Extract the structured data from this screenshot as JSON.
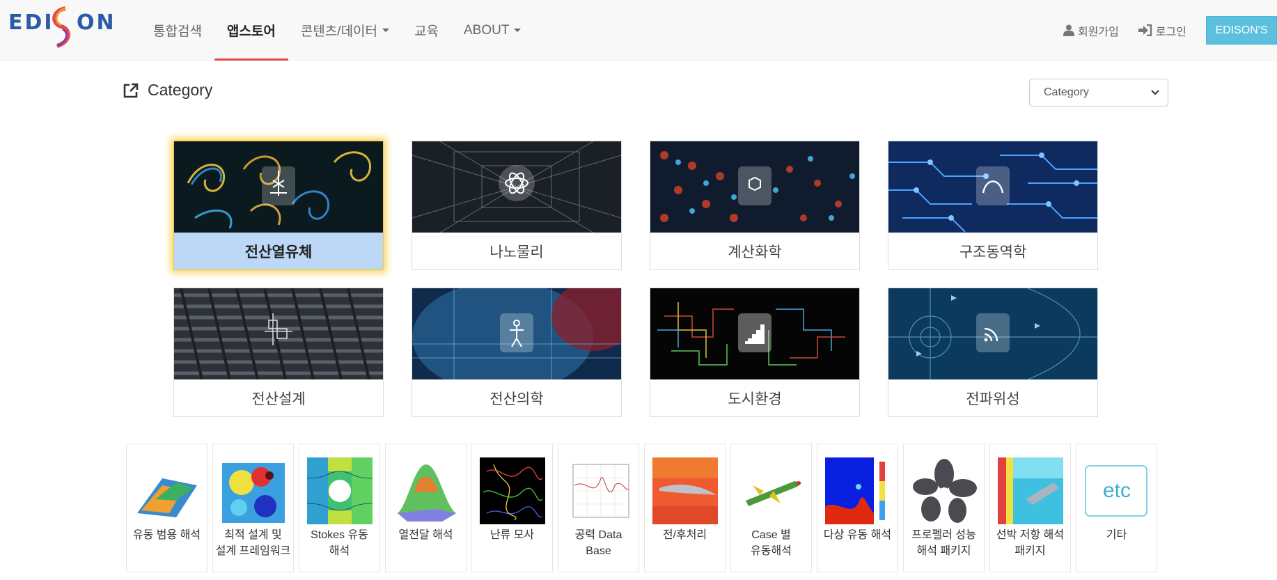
{
  "header": {
    "logo": "EDISON",
    "nav": [
      {
        "label": "통합검색"
      },
      {
        "label": "앱스토어",
        "active": true
      },
      {
        "label": "콘텐츠/데이터",
        "dropdown": true
      },
      {
        "label": "교육"
      },
      {
        "label": "ABOUT",
        "dropdown": true
      }
    ],
    "signup": "회원가입",
    "login": "로그인",
    "edisons": "EDISON'S"
  },
  "category": {
    "title": "Category",
    "select_value": "Category"
  },
  "cards": [
    {
      "label": "전산열유체",
      "icon": "satellite-dish-icon",
      "active": true
    },
    {
      "label": "나노물리",
      "icon": "atom-icon"
    },
    {
      "label": "계산화학",
      "icon": "molecule-icon"
    },
    {
      "label": "구조동역학",
      "icon": "bridge-icon"
    },
    {
      "label": "전산설계",
      "icon": "design-grid-icon"
    },
    {
      "label": "전산의학",
      "icon": "human-body-icon"
    },
    {
      "label": "도시환경",
      "icon": "buildings-icon"
    },
    {
      "label": "전파위성",
      "icon": "wifi-icon"
    }
  ],
  "apps": [
    {
      "line1": "유동 범용 해석",
      "line2": ""
    },
    {
      "line1": "최적 설계 및",
      "line2": "설계 프레임워크"
    },
    {
      "line1": "Stokes 유동",
      "line2": "해석"
    },
    {
      "line1": "열전달 해석",
      "line2": ""
    },
    {
      "line1": "난류 모사",
      "line2": ""
    },
    {
      "line1": "공력 Data",
      "line2": "Base"
    },
    {
      "line1": "전/후처리",
      "line2": ""
    },
    {
      "line1": "Case 별",
      "line2": "유동해석"
    },
    {
      "line1": "다상 유동 해석",
      "line2": ""
    },
    {
      "line1": "프로펠러 성능",
      "line2": "해석 패키지"
    },
    {
      "line1": "선박 저항 해석",
      "line2": "패키지"
    },
    {
      "line1": "기타",
      "line2": "",
      "thumb_text": "etc"
    }
  ],
  "colors": {
    "accent": "#e24a4a",
    "button": "#5bc0de",
    "selected_label": "#bcd8f6",
    "glow": "#f6d65e",
    "logo_blue": "#2a5aa8"
  }
}
